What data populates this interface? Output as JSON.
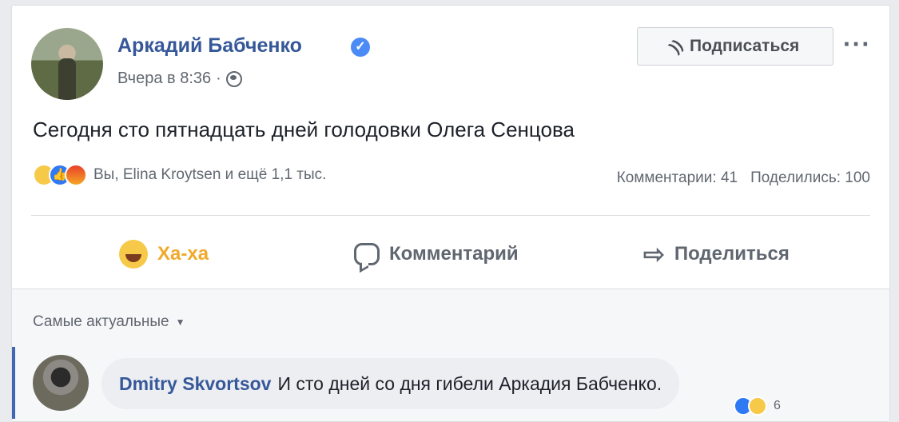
{
  "post": {
    "author": "Аркадий Бабченко",
    "verified_icon": "verified-check-icon",
    "time": "Вчера в 8:36",
    "time_separator": "·",
    "privacy_icon": "globe-icon",
    "follow_label": "Подписаться",
    "follow_icon": "rss-icon",
    "more_label": "···",
    "text": "Сегодня сто пятнадцать дней голодовки Олега Сенцова",
    "reactions": [
      "sad",
      "like",
      "angry"
    ],
    "reaction_summary": "Вы, Elina Kroytsen и ещё 1,1 тыс.",
    "comments_count": "Комментарии: 41",
    "shares_count": "Поделились: 100"
  },
  "actions": {
    "haha": "Ха-ха",
    "comment": "Комментарий",
    "share": "Поделиться"
  },
  "comments": {
    "sort_label": "Самые актуальные",
    "items": [
      {
        "author": "Dmitry Skvortsov",
        "text": "И сто дней со дня гибели Аркадия Бабченко.",
        "reaction_count": "6"
      }
    ]
  },
  "colors": {
    "link": "#365899",
    "secondary": "#616770",
    "haha": "#f0a92a",
    "like": "#2f79f5",
    "background": "#e9ebee"
  }
}
